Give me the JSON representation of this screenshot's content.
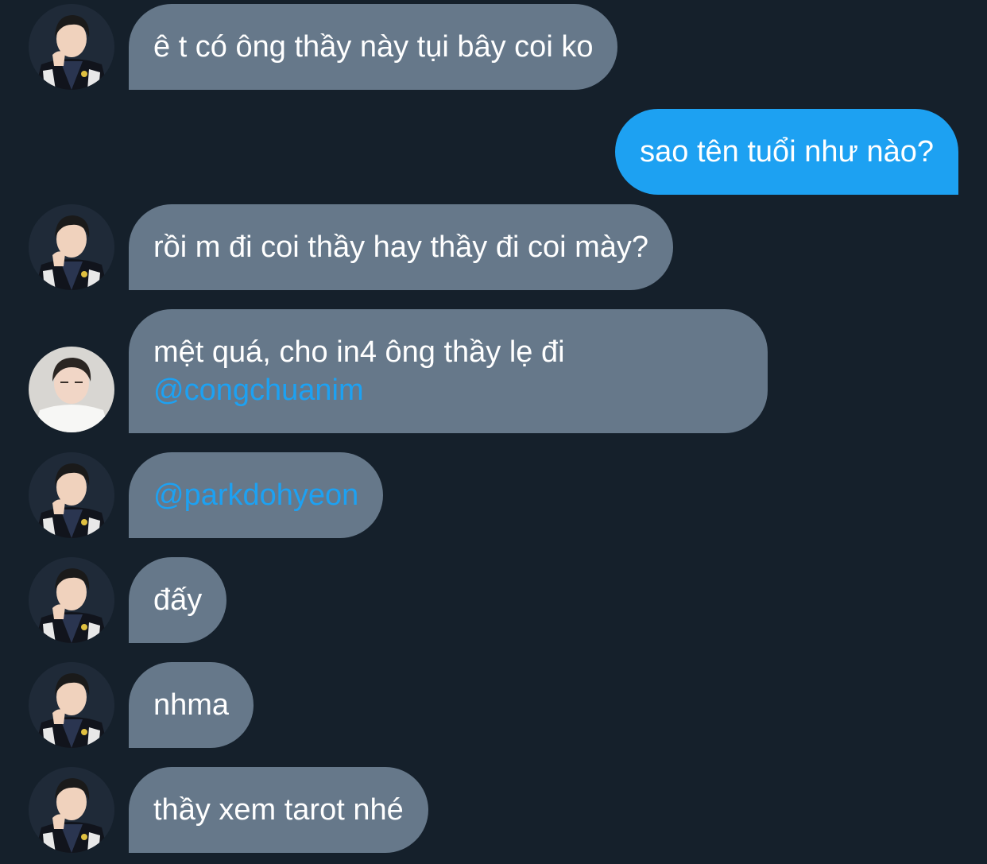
{
  "colors": {
    "background": "#15202b",
    "incoming_bubble": "#66788a",
    "outgoing_bubble": "#1da1f2",
    "mention": "#1da1f2",
    "text": "#ffffff"
  },
  "messages": [
    {
      "direction": "incoming",
      "avatar": "avatar-icon-player",
      "text": "ê t có ông thầy này tụi bây coi ko"
    },
    {
      "direction": "outgoing",
      "text": "sao tên tuổi như nào?"
    },
    {
      "direction": "incoming",
      "avatar": "avatar-icon-player",
      "text": "rồi m đi coi thầy hay thầy đi coi mày?"
    },
    {
      "direction": "incoming",
      "avatar": "avatar-icon-white-shirt",
      "text": "mệt quá, cho in4 ông thầy lẹ đi",
      "mention": "@congchuanim"
    },
    {
      "direction": "incoming",
      "avatar": "avatar-icon-player",
      "mention": "@parkdohyeon"
    },
    {
      "direction": "incoming",
      "avatar": "avatar-icon-player",
      "text": "đấy"
    },
    {
      "direction": "incoming",
      "avatar": "avatar-icon-player",
      "text": "nhma"
    },
    {
      "direction": "incoming",
      "avatar": "avatar-icon-player",
      "text": "thầy xem tarot nhé"
    }
  ]
}
